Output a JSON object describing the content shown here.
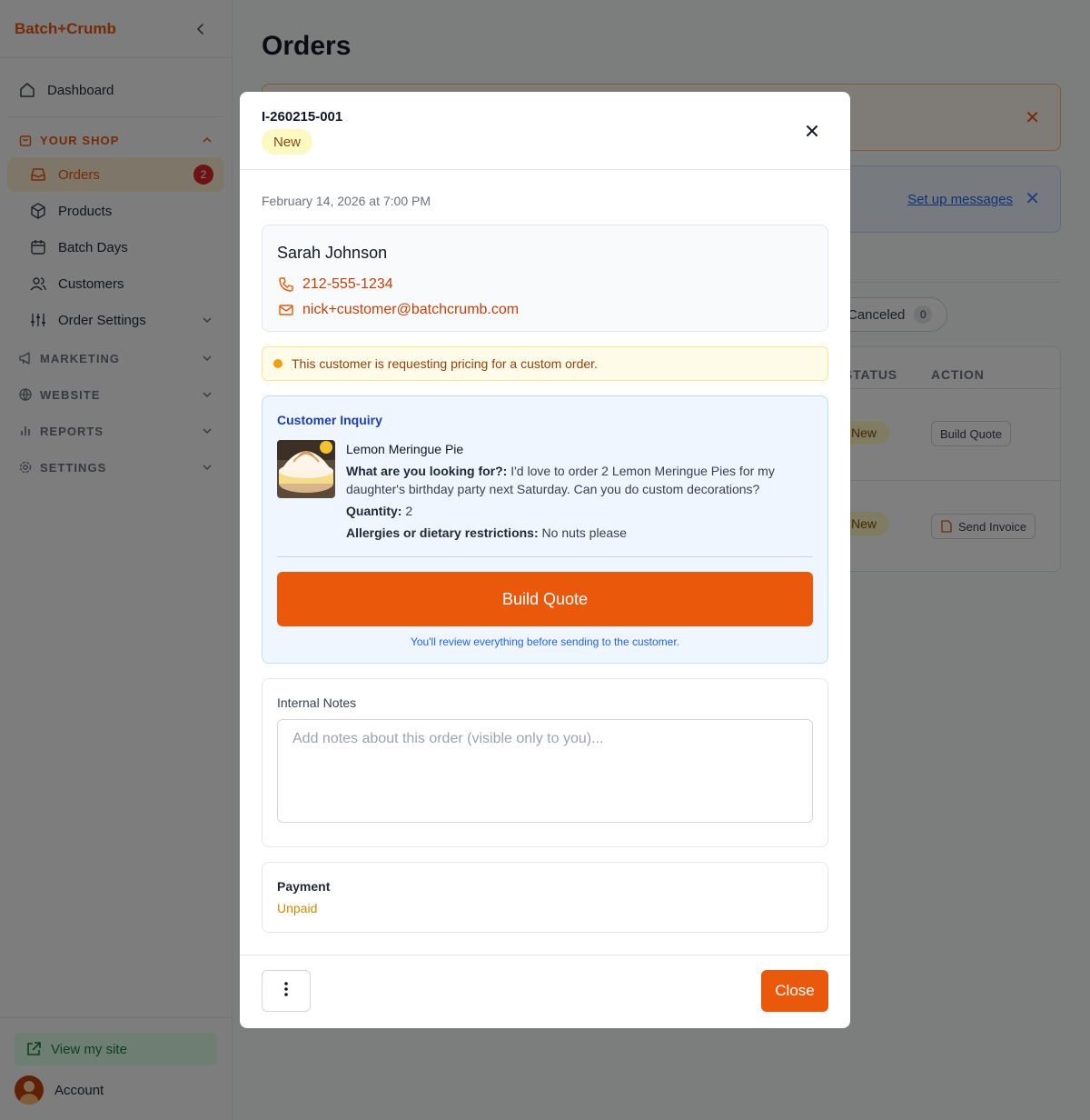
{
  "app": {
    "brand": "Batch+Crumb"
  },
  "sidebar": {
    "dashboard": "Dashboard",
    "your_shop": "YOUR SHOP",
    "shop_items": {
      "orders": {
        "label": "Orders",
        "badge": "2"
      },
      "products": "Products",
      "batch_days": "Batch Days",
      "customers": "Customers",
      "order_settings": "Order Settings"
    },
    "marketing": "MARKETING",
    "website": "WEBSITE",
    "reports": "REPORTS",
    "settings": "SETTINGS",
    "view_site": "View my site",
    "account": "Account"
  },
  "page": {
    "title": "Orders",
    "setup_link": "Set up messages",
    "filters": {
      "canceled": {
        "label": "Canceled",
        "count": "0"
      }
    },
    "table": {
      "columns": {
        "status": "STATUS",
        "action": "ACTION"
      },
      "rows": [
        {
          "status": "New",
          "action": "Build Quote"
        },
        {
          "status": "New",
          "action": "Send Invoice"
        }
      ]
    }
  },
  "modal": {
    "order_id": "I-260215-001",
    "status": "New",
    "date": "February 14, 2026 at 7:00 PM",
    "customer": {
      "name": "Sarah Johnson",
      "phone": "212-555-1234",
      "email": "nick+customer@batchcrumb.com"
    },
    "warning": "This customer is requesting pricing for a custom order.",
    "inquiry": {
      "title": "Customer Inquiry",
      "product": "Lemon Meringue Pie",
      "looking_for_label": "What are you looking for?:",
      "looking_for_value": "I'd love to order 2 Lemon Meringue Pies for my daughter's birthday party next Saturday. Can you do custom decorations?",
      "quantity_label": "Quantity:",
      "quantity_value": "2",
      "allergies_label": "Allergies or dietary restrictions:",
      "allergies_value": "No nuts please",
      "build_button": "Build Quote",
      "hint": "You'll review everything before sending to the customer."
    },
    "notes": {
      "label": "Internal Notes",
      "placeholder": "Add notes about this order (visible only to you)..."
    },
    "payment": {
      "label": "Payment",
      "status": "Unpaid"
    },
    "footer": {
      "close": "Close"
    }
  },
  "colors": {
    "accent": "#ea580c",
    "status_new_bg": "#fef9c3",
    "inquiry_bg": "#eff6ff",
    "unpaid": "#ca8a04"
  },
  "icons": [
    "chevron-left-icon",
    "home-icon",
    "shopping-bag-icon",
    "inbox-icon",
    "box-icon",
    "calendar-icon",
    "users-icon",
    "sliders-icon",
    "megaphone-icon",
    "globe-icon",
    "bar-chart-icon",
    "gear-icon",
    "external-link-icon",
    "phone-icon",
    "mail-icon",
    "close-icon",
    "more-vertical-icon",
    "file-icon"
  ]
}
